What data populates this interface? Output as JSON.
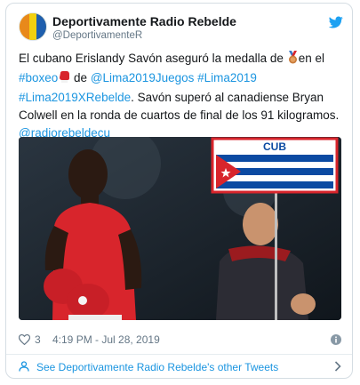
{
  "tweet": {
    "account_name": "Deportivamente Radio Rebelde",
    "handle": "@DeportivamenteR",
    "text": {
      "seg1": "El cubano Erislandy Savón aseguró la medalla de ",
      "seg2": "en el ",
      "hashtag_boxeo": "#boxeo",
      "seg3": " de ",
      "mention_lima2019juegos": "@Lima2019Juegos",
      "hashtag_lima2019": "#Lima2019",
      "hashtag_lima2019xrebelde": "#Lima2019XRebelde",
      "seg4": ". Savón superó al canadiense Bryan Colwell en la ronda de cuartos de final de los 91 kilogramos.",
      "mention_radiorebeldecu": "@radiorebeldecu"
    },
    "emoji_icons": [
      "bronze-medal-icon",
      "boxing-glove-icon"
    ],
    "media": {
      "banner_text": "CUB",
      "icons": [
        "cuban-flag-icon",
        "boxer-photo"
      ]
    },
    "likes": "3",
    "timestamp": "4:19 PM - Jul 28, 2019",
    "see_more": "See Deportivamente Radio Rebelde's other Tweets"
  },
  "colors": {
    "link": "#1b95e0",
    "text": "#14171a",
    "muted": "#657786",
    "border": "#d5dde3",
    "jersey": "#d8252c"
  }
}
